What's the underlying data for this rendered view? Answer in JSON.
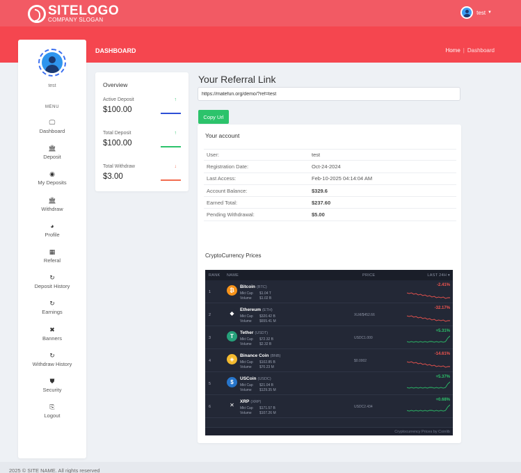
{
  "header": {
    "logo_title": "SITELOGO",
    "logo_slogan": "COMPANY SLOGAN",
    "user_name": "test"
  },
  "page": {
    "title": "DASHBOARD",
    "breadcrumb_home": "Home",
    "breadcrumb_current": "Dashboard"
  },
  "sidebar": {
    "user": "test",
    "menu_heading": "MENU",
    "items": [
      {
        "label": "Dashboard",
        "icon": "monitor-icon"
      },
      {
        "label": "Deposit",
        "icon": "bank-icon"
      },
      {
        "label": "My Deposits",
        "icon": "coin-icon"
      },
      {
        "label": "Withdraw",
        "icon": "bank-icon"
      },
      {
        "label": "Profile",
        "icon": "globe-icon"
      },
      {
        "label": "Referal",
        "icon": "calendar-icon"
      },
      {
        "label": "Deposit History",
        "icon": "refresh-icon"
      },
      {
        "label": "Earnings",
        "icon": "refresh-icon"
      },
      {
        "label": "Banners",
        "icon": "tools-icon"
      },
      {
        "label": "Withdraw History",
        "icon": "refresh-icon"
      },
      {
        "label": "Security",
        "icon": "shield-icon"
      },
      {
        "label": "Logout",
        "icon": "logout-icon"
      }
    ]
  },
  "overview": {
    "heading": "Overview",
    "rows": [
      {
        "label": "Active Deposit",
        "value": "$100.00",
        "arrow": "↑",
        "color": "#2d4fd6",
        "arrow_color": "#2cc36b"
      },
      {
        "label": "Total Deposit",
        "value": "$100.00",
        "arrow": "↑",
        "color": "#2cc36b",
        "arrow_color": "#2cc36b"
      },
      {
        "label": "Total Withdraw",
        "value": "$3.00",
        "arrow": "↓",
        "color": "#f26b4f",
        "arrow_color": "#f26b4f"
      }
    ]
  },
  "referral": {
    "heading": "Your Referral Link",
    "link": "https://matefun.org/demo/?ref=test",
    "copy_label": "Copy Url"
  },
  "account": {
    "heading": "Your account",
    "rows": [
      {
        "key": "User:",
        "value": "test",
        "bold": false
      },
      {
        "key": "Registration Date:",
        "value": "Oct-24-2024",
        "bold": false
      },
      {
        "key": "Last Access:",
        "value": "Feb-10-2025 04:14:04 AM",
        "bold": false
      },
      {
        "key": "Account Balance:",
        "value": "$329.6",
        "bold": true
      },
      {
        "key": "Earned Total:",
        "value": "$237.60",
        "bold": true
      },
      {
        "key": "Pending Withdrawal:",
        "value": "$5.00",
        "bold": true
      }
    ]
  },
  "crypto": {
    "heading": "CryptoCurrency Prices",
    "columns": {
      "rank": "RANK",
      "name": "NAME",
      "price": "PRICE",
      "last": "LAST 24H"
    },
    "mkt_label": "Mkt Cap",
    "vol_label": "Volume",
    "coins": [
      {
        "rank": "1",
        "name": "Bitcoin",
        "symbol": "(BTC)",
        "mkt": "$1.04 T",
        "vol": "$1.02 B",
        "price": "",
        "change": "-2.41%",
        "up": false,
        "color": "#f7931a",
        "glyph": "₿",
        "icon": "bitcoin-icon"
      },
      {
        "rank": "2",
        "name": "Ethereum",
        "symbol": "(ETH)",
        "mkt": "$320.42 B",
        "vol": "$655.41 M",
        "price": "XLM/$452.66",
        "change": "-32.17%",
        "up": false,
        "color": "#232836",
        "glyph": "◆",
        "icon": "ethereum-icon"
      },
      {
        "rank": "3",
        "name": "Tether",
        "symbol": "(USDT)",
        "mkt": "$72.32 B",
        "vol": "$2.32 B",
        "price": "USDC1.000",
        "change": "+5.31%",
        "up": true,
        "color": "#26a17b",
        "glyph": "T",
        "icon": "tether-icon"
      },
      {
        "rank": "4",
        "name": "Binance Coin",
        "symbol": "(BNB)",
        "mkt": "$102.85 B",
        "vol": "$70.23 M",
        "price": "$0.0002",
        "change": "-14.61%",
        "up": false,
        "color": "#f3ba2f",
        "glyph": "◈",
        "icon": "binance-icon"
      },
      {
        "rank": "5",
        "name": "USCoin",
        "symbol": "(USDC)",
        "mkt": "$21.04 B",
        "vol": "$129.35 M",
        "price": "",
        "change": "+5.37%",
        "up": true,
        "color": "#2775ca",
        "glyph": "$",
        "icon": "usdc-icon"
      },
      {
        "rank": "6",
        "name": "XRP",
        "symbol": "(XRP)",
        "mkt": "$171.57 B",
        "vol": "$107.26 M",
        "price": "USDC2.434",
        "change": "+0.68%",
        "up": true,
        "color": "#232836",
        "glyph": "✕",
        "icon": "xrp-icon"
      }
    ],
    "footer": "Cryptocurrency Prices by Coinlib"
  },
  "colors": {
    "brand": "#f5464f",
    "success": "#2cc36b",
    "down": "#f4554f"
  },
  "footer": {
    "text": "2025 © SITE NAME. All rights reserved"
  }
}
